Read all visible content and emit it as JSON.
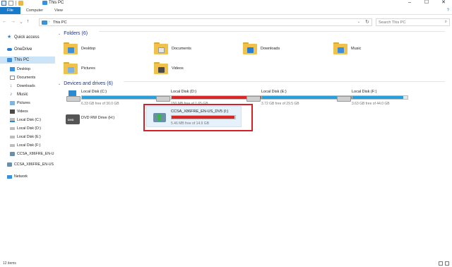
{
  "window": {
    "title": "This PC",
    "controls": [
      "–",
      "☐",
      "✕"
    ]
  },
  "ribbon": {
    "tabs": [
      "File",
      "Computer",
      "View"
    ]
  },
  "address": {
    "path": "This PC",
    "search_placeholder": "Search This PC"
  },
  "sidebar": {
    "items": [
      {
        "label": "Quick access"
      },
      {
        "label": "OneDrive"
      },
      {
        "label": "This PC"
      },
      {
        "label": "Desktop"
      },
      {
        "label": "Documents"
      },
      {
        "label": "Downloads"
      },
      {
        "label": "Music"
      },
      {
        "label": "Pictures"
      },
      {
        "label": "Videos"
      },
      {
        "label": "Local Disk (C:)"
      },
      {
        "label": "Local Disk (D:)"
      },
      {
        "label": "Local Disk (E:)"
      },
      {
        "label": "Local Disk (F:)"
      },
      {
        "label": "CCSA_X86FRE_EN-U"
      },
      {
        "label": "CCSA_X86FRE_EN-US"
      },
      {
        "label": "Network"
      }
    ]
  },
  "folders": {
    "header": "Folders (6)",
    "items": [
      {
        "label": "Desktop",
        "badge": "#3d8fd9"
      },
      {
        "label": "Documents",
        "badge": "#e6e6e6"
      },
      {
        "label": "Downloads",
        "badge": "#2a7fd4"
      },
      {
        "label": "Music",
        "badge": "#3d8fd9"
      },
      {
        "label": "Pictures",
        "badge": "#7fb3e0"
      },
      {
        "label": "Videos",
        "badge": "#4a4a4a"
      }
    ]
  },
  "drives": {
    "header": "Devices and drives (6)",
    "items": [
      {
        "name": "Local Disk (C:)",
        "free": "6.33 GB free of 30.0 GB",
        "used_fraction": 0.79,
        "bar_color": "#26a0da"
      },
      {
        "name": "Local Disk (D:)",
        "free": "150 MB free of 1.65 GB",
        "used_fraction": 0.91,
        "bar_color": "#da2626"
      },
      {
        "name": "Local Disk (E:)",
        "free": "3.72 GB free of 29.5 GB",
        "used_fraction": 0.87,
        "bar_color": "#26a0da"
      },
      {
        "name": "Local Disk  (F:)",
        "free": "3.63 GB free of 44.0 GB",
        "used_fraction": 0.92,
        "bar_color": "#26a0da"
      },
      {
        "name": "DVD RW Drive (H:)",
        "free": "",
        "used_fraction": 0,
        "bar_color": ""
      },
      {
        "name": "CCSA_X86FRE_EN-US_DV5 (I:)",
        "free": "5.46 MB free of 14.9 GB",
        "used_fraction": 0.99,
        "bar_color": "#da2626"
      }
    ]
  },
  "dvd_icon_text": "DVD",
  "status": {
    "items_count": "12 items"
  }
}
